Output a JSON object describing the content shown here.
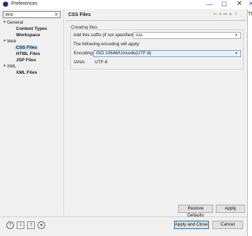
{
  "window": {
    "title": "Preferences",
    "minimize": "—",
    "maximize": "☐",
    "close": "✕"
  },
  "outside": {
    "close_glyph": "✕",
    "text": "Th"
  },
  "filter": {
    "value": "enc",
    "clear": "✕"
  },
  "tree": [
    {
      "label": "General",
      "arrow": "▼",
      "bold": false
    },
    {
      "label": "Content Types",
      "arrow": "",
      "bold": true
    },
    {
      "label": "Workspace",
      "arrow": "",
      "bold": true
    },
    {
      "label": "Web",
      "arrow": "▼",
      "bold": false
    },
    {
      "label": "CSS Files",
      "arrow": "",
      "bold": true,
      "selected": true
    },
    {
      "label": "HTML Files",
      "arrow": "",
      "bold": true
    },
    {
      "label": "JSP Files",
      "arrow": "",
      "bold": true
    },
    {
      "label": "XML",
      "arrow": "▼",
      "bold": false
    },
    {
      "label": "XML Files",
      "arrow": "",
      "bold": true
    }
  ],
  "page": {
    "title": "CSS Files",
    "nav_back": "⇦",
    "nav_back_dd": "▼",
    "nav_fwd": "⇨",
    "nav_fwd_dd": "▼",
    "menu": "⋮"
  },
  "creating": {
    "section_label": "Creating files",
    "suffix_label": "Add this suffix (if not specified):",
    "suffix_value": "css",
    "encoding_note": "The following encoding will apply:",
    "encoding_label": "Encoding:",
    "encoding_value": "ISO 10646/Unicode(UTF-8)",
    "iana_label": "IANA:",
    "iana_value": "UTF-8"
  },
  "buttons": {
    "restore_defaults": "Restore Defaults",
    "apply": "Apply",
    "apply_and_close": "Apply and Close",
    "cancel": "Cancel"
  },
  "footer_icons": [
    "help-icon",
    "import-icon",
    "export-icon",
    "record-icon"
  ]
}
